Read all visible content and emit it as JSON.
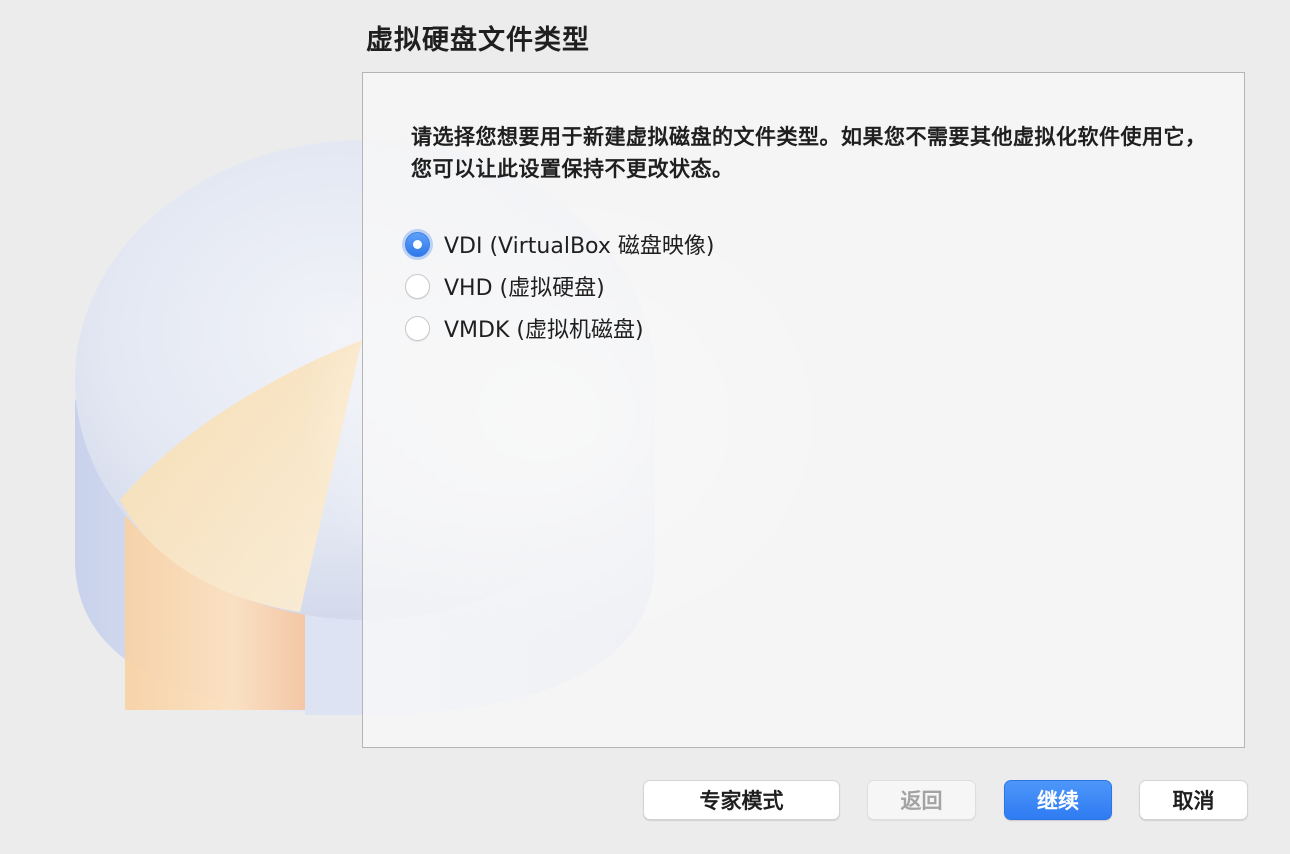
{
  "dialog": {
    "title": "虚拟硬盘文件类型",
    "description": "请选择您想要用于新建虚拟磁盘的文件类型。如果您不需要其他虚拟化软件使用它，您可以让此设置保持不更改状态。",
    "options": [
      {
        "label": "VDI (VirtualBox 磁盘映像)",
        "checked": true
      },
      {
        "label": "VHD (虚拟硬盘)",
        "checked": false
      },
      {
        "label": "VMDK (虚拟机磁盘)",
        "checked": false
      }
    ]
  },
  "buttons": {
    "expert": "专家模式",
    "back": "返回",
    "continue": "继续",
    "cancel": "取消"
  },
  "colors": {
    "accent": "#2f7bf2",
    "pie_slice": "#f5d6a6",
    "pie_body": "#dfe6f5"
  },
  "icons": {
    "illustration": "hard-disk-pie-icon"
  }
}
